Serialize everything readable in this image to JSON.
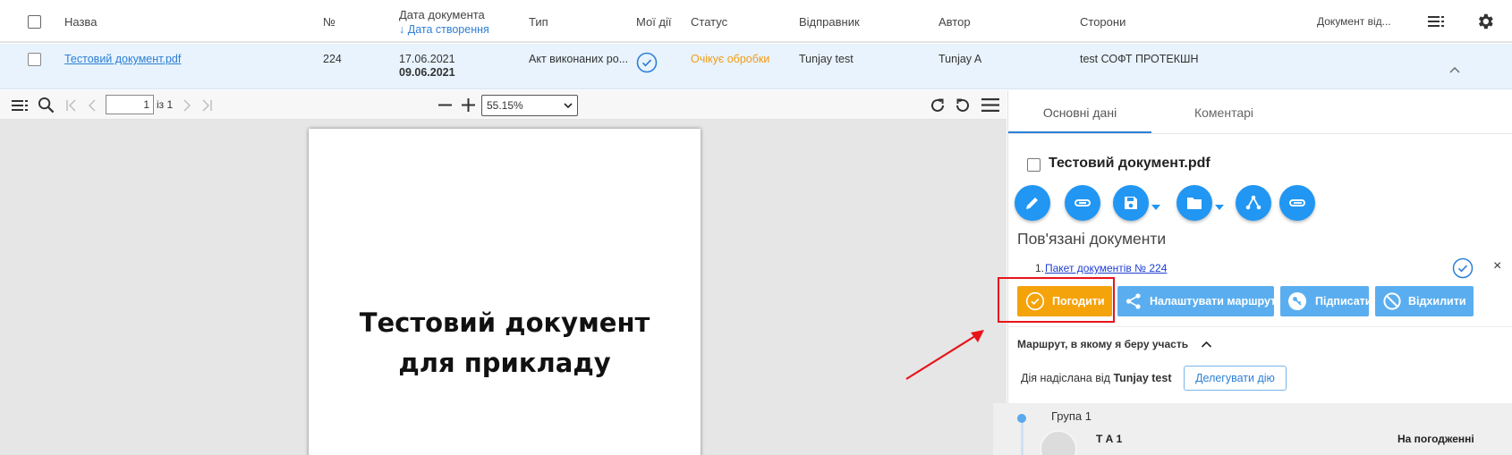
{
  "table": {
    "columns": {
      "name": "Назва",
      "number": "№",
      "doc_date": "Дата документа",
      "created_date": "↓ Дата створення",
      "type": "Тип",
      "my_actions": "Мої дії",
      "status": "Статус",
      "sender": "Відправник",
      "author": "Автор",
      "parties": "Сторони",
      "document_from": "Документ від..."
    },
    "row": {
      "name": "Тестовий документ.pdf",
      "number": "224",
      "doc_date": "17.06.2021",
      "created_date": "09.06.2021",
      "type": "Акт виконаних ро...",
      "status": "Очікує обробки",
      "sender": "Tunjay test",
      "author": "Tunjay A",
      "parties": "test СОФТ ПРОТЕКШН"
    }
  },
  "viewer": {
    "page_current": "1",
    "page_of": "із 1",
    "zoom": "55.15%",
    "page_line1": "Тестовий документ",
    "page_line2": "для прикладу"
  },
  "panel": {
    "tabs": [
      "Основні дані",
      "Коментарі"
    ],
    "doc_title": "Тестовий документ.pdf",
    "related_heading": "Пов'язані документи",
    "related_index": "1.",
    "related_link": "Пакет документів № 224",
    "close_symbol": "×",
    "actions": {
      "approve": "Погодити",
      "route": "Налаштувати маршрут",
      "sign": "Підписати",
      "reject": "Відхилити"
    },
    "route_heading": "Маршрут, в якому я беру участь",
    "action_sent_prefix": "Дія надіслана від",
    "action_sent_from": "Tunjay test",
    "delegate": "Делегувати дію",
    "group": "Група 1",
    "member": "Т А 1",
    "member_status": "На погодженні"
  },
  "colors": {
    "accent": "#2196f3",
    "approve": "#f5a30b",
    "pending": "#f39c12",
    "highlight": "#e8141a"
  },
  "icons": [
    "checkbox",
    "check-circle-icon",
    "menu-icon",
    "settings-gear-icon",
    "chevron-up-icon",
    "search-icon",
    "first-page-icon",
    "prev-page-icon",
    "next-page-icon",
    "last-page-icon",
    "zoom-out-icon",
    "zoom-in-icon",
    "rotate-cw-icon",
    "rotate-ccw-icon",
    "edit-icon",
    "link-icon",
    "save-icon",
    "folder-icon",
    "route-icon",
    "attach-icon",
    "share-icon",
    "key-icon",
    "block-icon",
    "avatar"
  ]
}
